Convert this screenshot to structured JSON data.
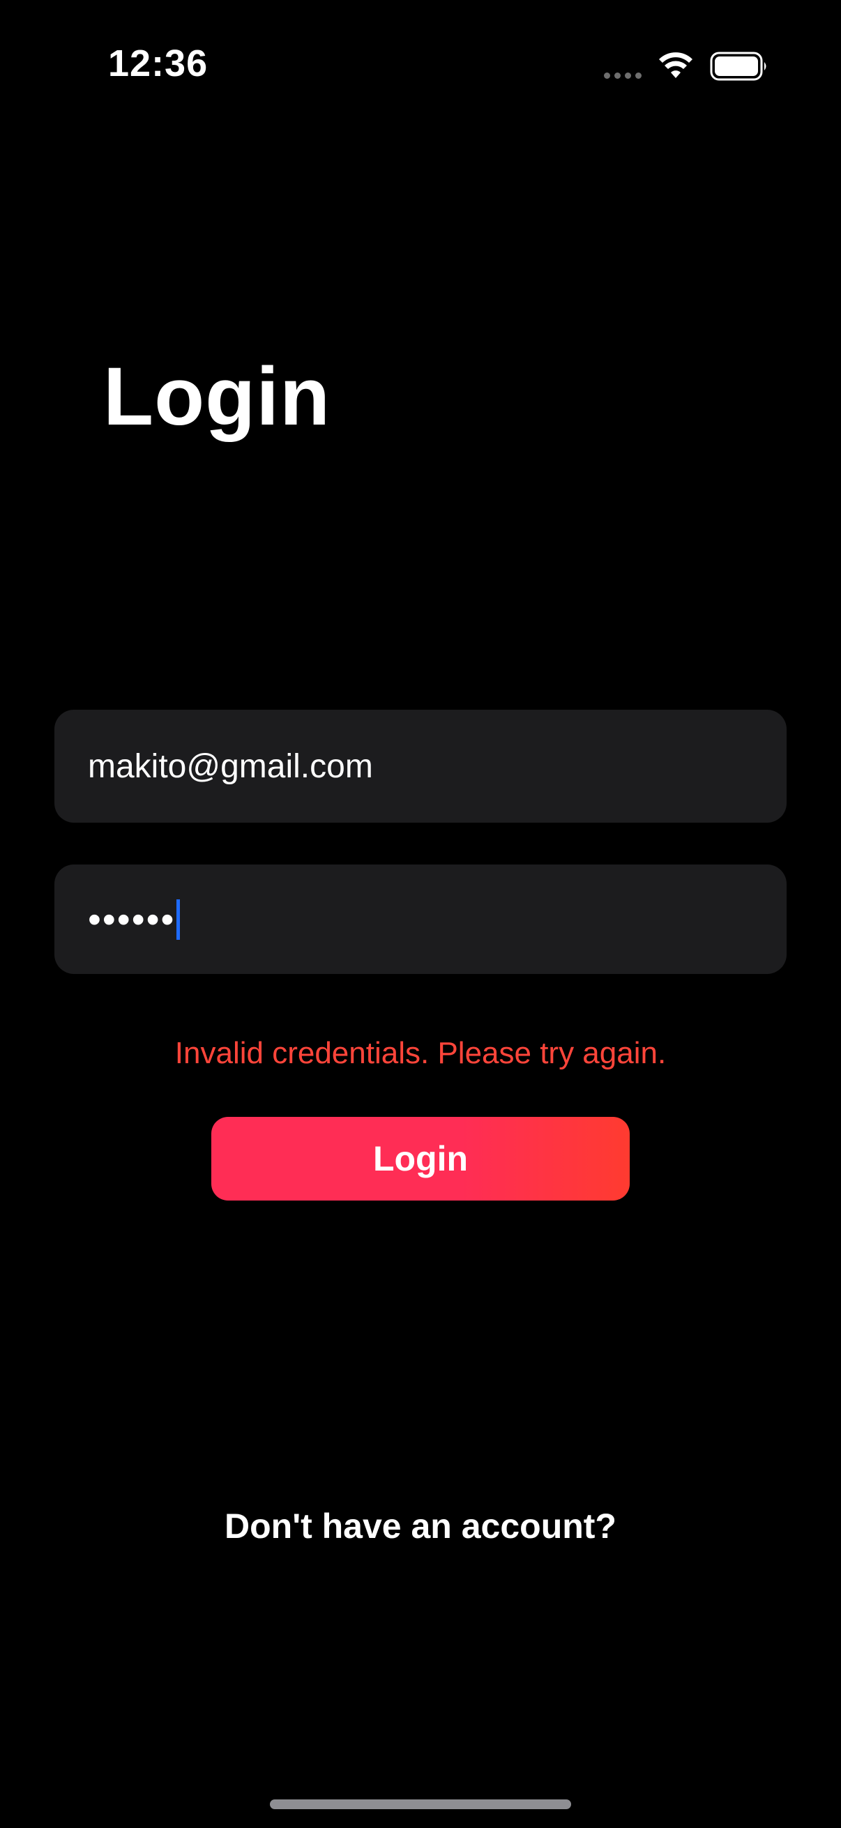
{
  "status_bar": {
    "time": "12:36",
    "icons": [
      "cellular-signal-icon",
      "wifi-icon",
      "battery-icon"
    ]
  },
  "page": {
    "title": "Login"
  },
  "form": {
    "email": {
      "value": "makito@gmail.com",
      "placeholder": ""
    },
    "password": {
      "value": "••••••",
      "masked": true,
      "caret_color": "#1e6bff"
    },
    "error_message": "Invalid credentials. Please try again.",
    "login_button_label": "Login",
    "signup_link": "Don't have an account?"
  },
  "colors": {
    "background": "#000000",
    "field_background": "#1c1c1e",
    "error": "#ff453a",
    "button_gradient_start": "#ff2d55",
    "button_gradient_end": "#ff3b30",
    "text": "#ffffff"
  }
}
